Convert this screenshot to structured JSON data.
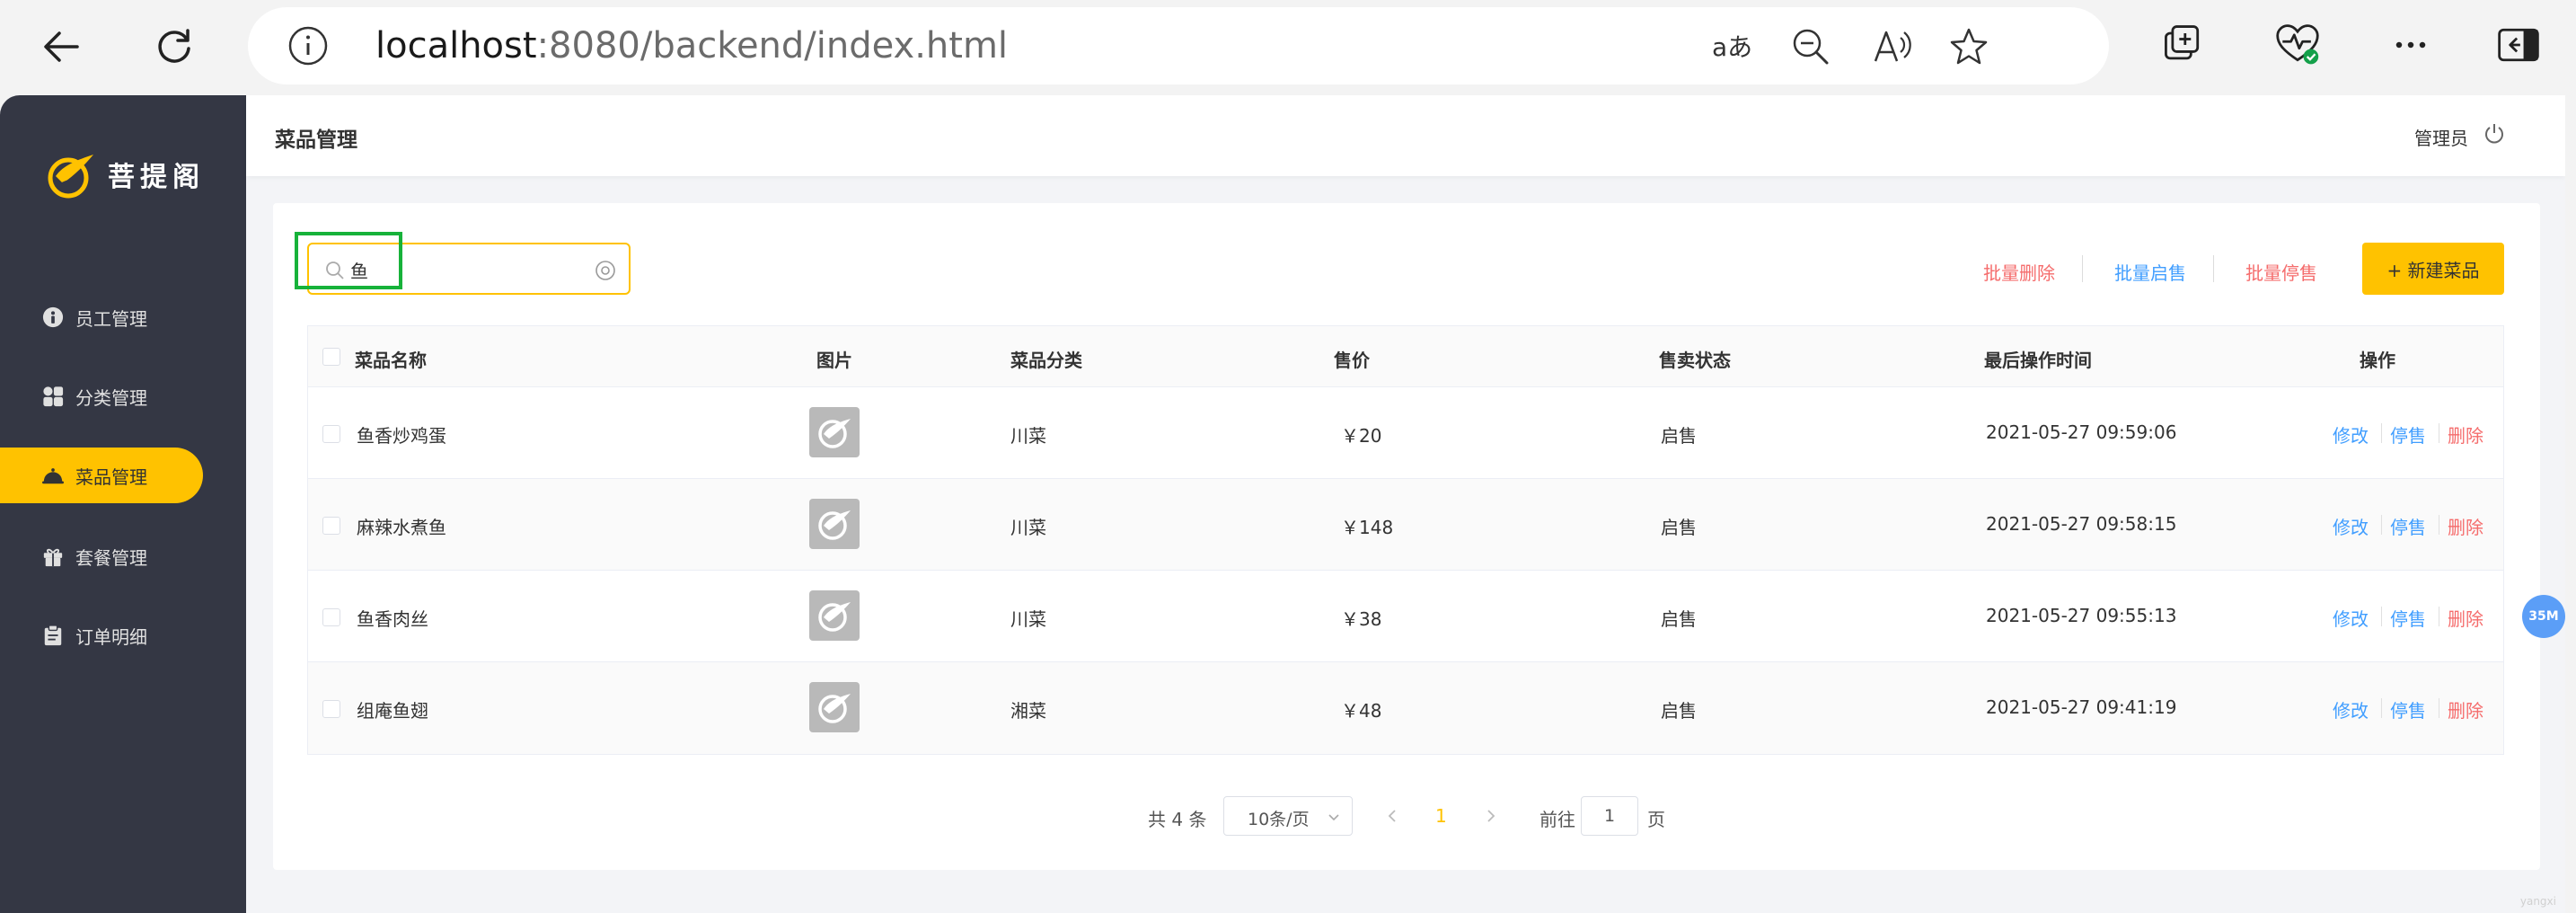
{
  "browser": {
    "url_host": "localhost",
    "url_path": ":8080/backend/index.html"
  },
  "sidebar": {
    "logo_text": "菩提阁",
    "items": [
      {
        "label": "员工管理",
        "icon": "person-info-icon"
      },
      {
        "label": "分类管理",
        "icon": "grid-icon"
      },
      {
        "label": "菜品管理",
        "icon": "dish-cover-icon"
      },
      {
        "label": "套餐管理",
        "icon": "gift-icon"
      },
      {
        "label": "订单明细",
        "icon": "clipboard-icon"
      }
    ],
    "active_index": 2
  },
  "header": {
    "title": "菜品管理",
    "user": "管理员"
  },
  "toolbar": {
    "search_value": "鱼",
    "batch_delete": "批量删除",
    "batch_enable": "批量启售",
    "batch_disable": "批量停售",
    "new_dish": "+ 新建菜品"
  },
  "table": {
    "columns": [
      "菜品名称",
      "图片",
      "菜品分类",
      "售价",
      "售卖状态",
      "最后操作时间",
      "操作"
    ],
    "rows": [
      {
        "name": "鱼香炒鸡蛋",
        "category": "川菜",
        "price": "￥20",
        "status": "启售",
        "updated": "2021-05-27 09:59:06"
      },
      {
        "name": "麻辣水煮鱼",
        "category": "川菜",
        "price": "￥148",
        "status": "启售",
        "updated": "2021-05-27 09:58:15"
      },
      {
        "name": "鱼香肉丝",
        "category": "川菜",
        "price": "￥38",
        "status": "启售",
        "updated": "2021-05-27 09:55:13"
      },
      {
        "name": "组庵鱼翅",
        "category": "湘菜",
        "price": "￥48",
        "status": "启售",
        "updated": "2021-05-27 09:41:19"
      }
    ],
    "actions": {
      "edit": "修改",
      "disable": "停售",
      "delete": "删除"
    }
  },
  "pagination": {
    "total": "共 4 条",
    "page_size": "10条/页",
    "current": "1",
    "goto_label": "前往",
    "goto_value": "1",
    "page_unit": "页"
  },
  "float_badge": "35M",
  "watermark": "yangxi",
  "colors": {
    "accent": "#ffc200",
    "sidebar_bg": "#343744",
    "link_blue": "#419eff",
    "link_red": "#f56c6c",
    "highlight_green": "#17b23a"
  }
}
